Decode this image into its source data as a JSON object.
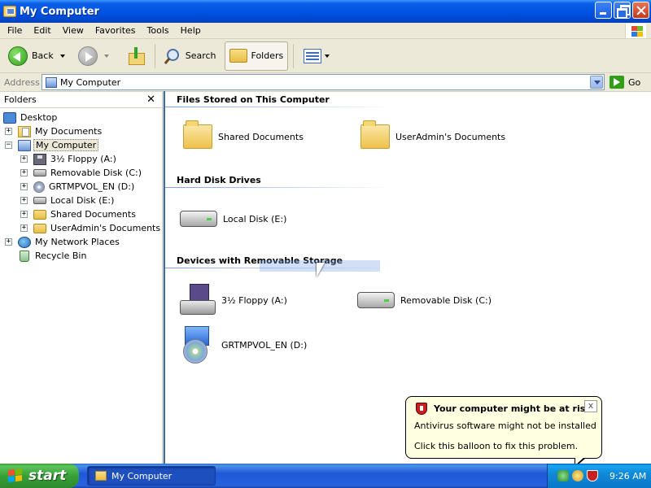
{
  "window": {
    "title": "My Computer"
  },
  "menu": [
    "File",
    "Edit",
    "View",
    "Favorites",
    "Tools",
    "Help"
  ],
  "toolbar": {
    "back": "Back",
    "search": "Search",
    "folders": "Folders"
  },
  "address": {
    "label": "Address",
    "value": "My Computer",
    "go": "Go"
  },
  "folders_pane": {
    "title": "Folders",
    "close": "✕",
    "tree": [
      {
        "label": "Desktop",
        "icon": "desktop-icon",
        "toggle": ""
      },
      {
        "label": "My Documents",
        "icon": "my-documents-icon",
        "toggle": "+"
      },
      {
        "label": "My Computer",
        "icon": "my-computer-icon",
        "toggle": "−",
        "selected": true
      },
      {
        "label": "3½ Floppy (A:)",
        "icon": "floppy-icon",
        "toggle": "+"
      },
      {
        "label": "Removable Disk (C:)",
        "icon": "drive-icon",
        "toggle": "+"
      },
      {
        "label": "GRTMPVOL_EN (D:)",
        "icon": "cd-icon",
        "toggle": "+"
      },
      {
        "label": "Local Disk (E:)",
        "icon": "drive-icon",
        "toggle": "+"
      },
      {
        "label": "Shared Documents",
        "icon": "folder-icon",
        "toggle": "+"
      },
      {
        "label": "UserAdmin's Documents",
        "icon": "folder-icon",
        "toggle": "+"
      },
      {
        "label": "My Network Places",
        "icon": "network-icon",
        "toggle": "+"
      },
      {
        "label": "Recycle Bin",
        "icon": "recycle-bin-icon",
        "toggle": ""
      }
    ]
  },
  "content": {
    "groups": [
      {
        "title": "Files Stored on This Computer",
        "items": [
          "Shared Documents",
          "UserAdmin's Documents"
        ]
      },
      {
        "title": "Hard Disk Drives",
        "items": [
          "Local Disk (E:)"
        ]
      },
      {
        "title": "Devices with Removable Storage",
        "items": [
          "3½ Floppy (A:)",
          "Removable Disk (C:)",
          "GRTMPVOL_EN (D:)"
        ]
      }
    ]
  },
  "balloon": {
    "title": "Your computer might be at risk",
    "line1": "Antivirus software might not be installed",
    "line2": "Click this balloon to fix this problem.",
    "close": "x"
  },
  "taskbar": {
    "start": "start",
    "task": "My Computer",
    "clock": "9:26 AM"
  }
}
